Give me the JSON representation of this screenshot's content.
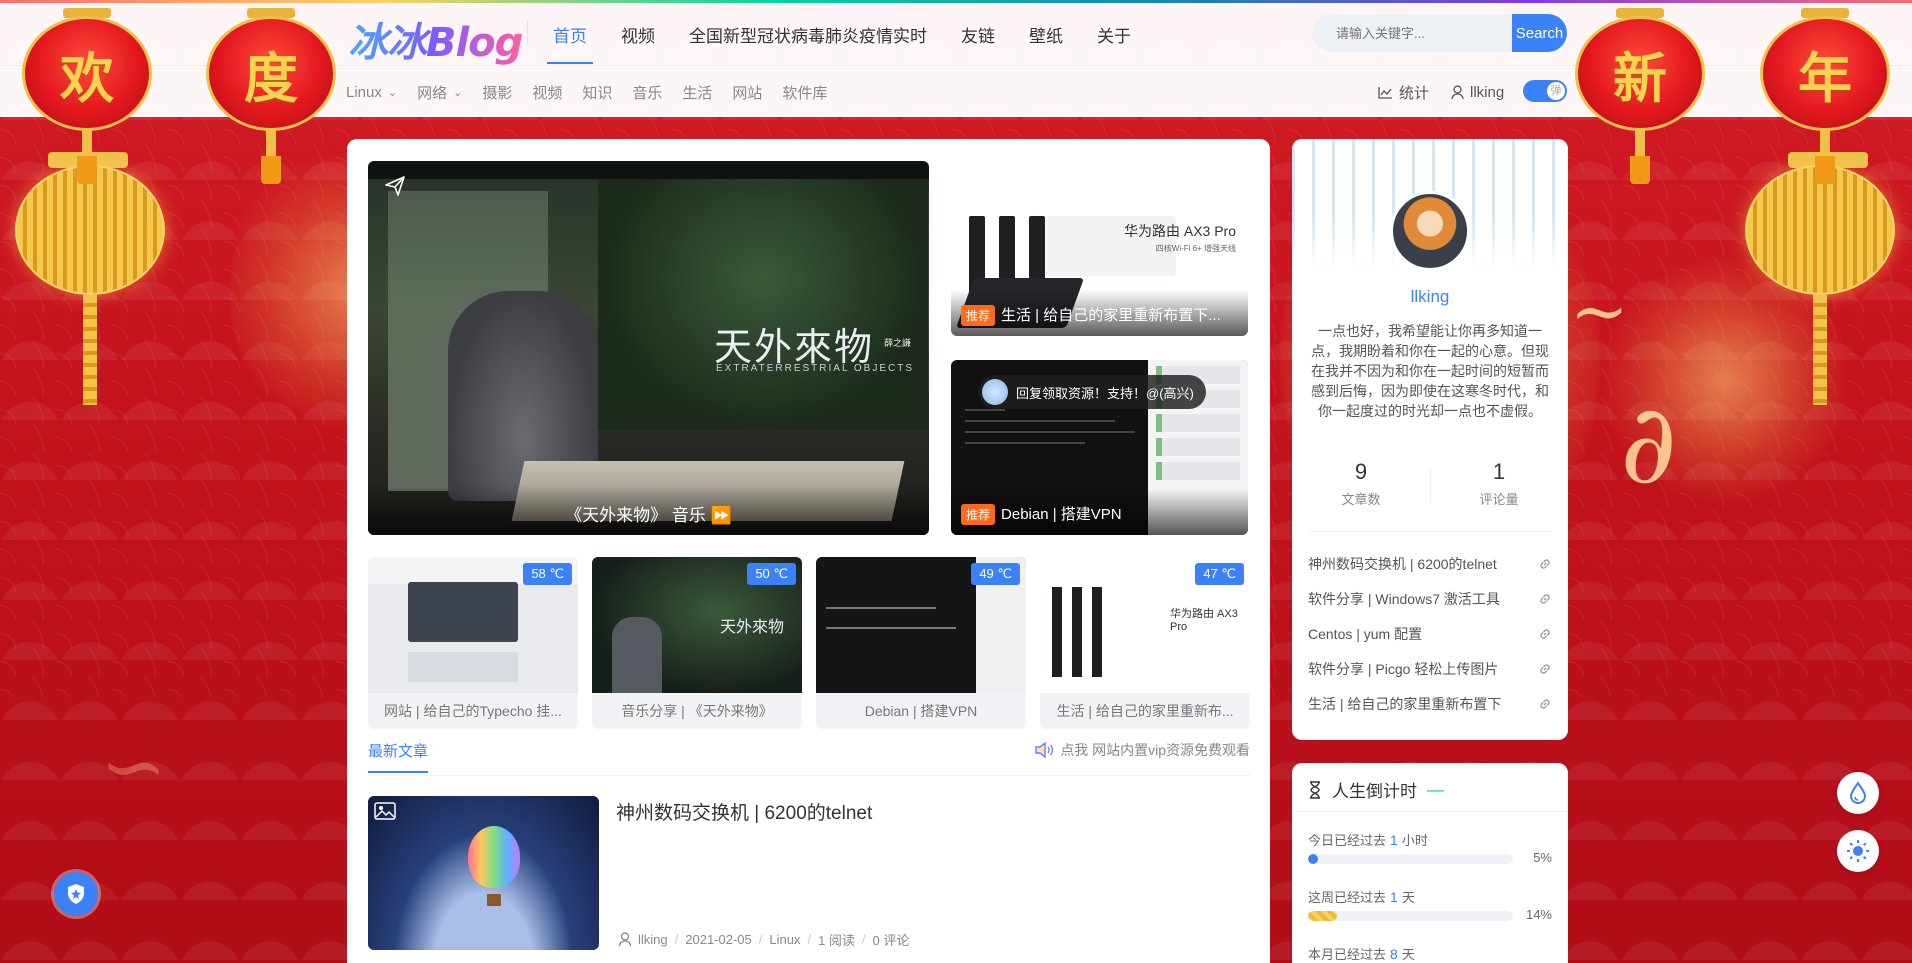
{
  "lanterns": [
    "欢",
    "度",
    "新",
    "年"
  ],
  "header": {
    "logo": "冰冰Blog",
    "nav": [
      "首页",
      "视频",
      "全国新型冠状病毒肺炎疫情实时",
      "友链",
      "壁纸",
      "关于"
    ],
    "search_placeholder": "请输入关键字...",
    "search_button": "Search",
    "subnav": [
      "Linux",
      "网络",
      "摄影",
      "视频",
      "知识",
      "音乐",
      "生活",
      "网站",
      "软件库"
    ],
    "stats_label": "统计",
    "user_label": "llking",
    "toggle_label": "弹"
  },
  "hero": {
    "title_cn": "天外來物",
    "title_cn_small": "薛之謙",
    "title_en": "EXTRATERRESTRIAL OBJECTS",
    "caption": "《天外来物》 音乐 ⏩"
  },
  "side_posts": [
    {
      "badge": "推荐",
      "title": "生活 | 给自己的家里重新布置下...",
      "router_label": "华为路由 AX3 Pro",
      "router_sub": "四核Wi-Fi 6+ 增强天线"
    },
    {
      "badge": "推荐",
      "title": "Debian | 搭建VPN"
    }
  ],
  "chat_pill": "回复领取资源！支持！@(高兴)",
  "thumbs": [
    {
      "temp": "58 ℃",
      "title": "网站 | 给自己的Typecho 挂..."
    },
    {
      "temp": "50 ℃",
      "title": "音乐分享 | 《天外来物》"
    },
    {
      "temp": "49 ℃",
      "title": "Debian | 搭建VPN"
    },
    {
      "temp": "47 ℃",
      "title": "生活 | 给自己的家里重新布..."
    }
  ],
  "tabs": {
    "latest": "最新文章",
    "notice": "点我 网站内置vip资源免费观看"
  },
  "post": {
    "title": "神州数码交换机 | 6200的telnet",
    "author": "llking",
    "date": "2021-02-05",
    "category": "Linux",
    "reads": "1 阅读",
    "comments": "0 评论"
  },
  "profile": {
    "name": "llking",
    "bio": "一点也好，我希望能让你再多知道一点，我期盼着和你在一起的心意。但现在我并不因为和你在一起时间的短暂而感到后悔，因为即使在这寒冬时代，和你一起度过的时光却一点也不虚假。",
    "posts_count": "9",
    "posts_label": "文章数",
    "comments_count": "1",
    "comments_label": "评论量",
    "links": [
      "神州数码交换机 | 6200的telnet",
      "软件分享 | Windows7 激活工具",
      "Centos | yum 配置",
      "软件分享 | Picgo 轻松上传图片",
      "生活 | 给自己的家里重新布置下"
    ]
  },
  "countdown": {
    "title": "人生倒计时",
    "items": [
      {
        "prefix": "今日已经过去",
        "value": "1",
        "unit": "小时",
        "percent": 5,
        "percent_label": "5%",
        "color": "#3b82f6"
      },
      {
        "prefix": "这周已经过去",
        "value": "1",
        "unit": "天",
        "percent": 14,
        "percent_label": "14%",
        "color": "#f5b82e"
      },
      {
        "prefix": "本月已经过去",
        "value": "8",
        "unit": "天"
      }
    ]
  },
  "colors": {
    "accent": "#3b82f6",
    "badge": "#ff6a1a",
    "festive_red": "#c8101c"
  }
}
